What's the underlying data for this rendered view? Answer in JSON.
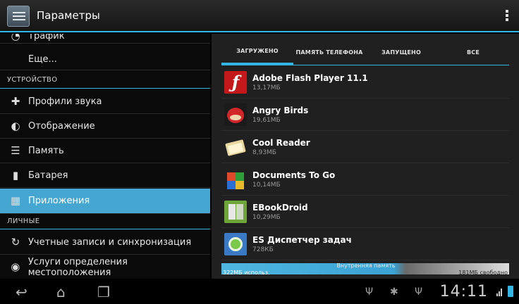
{
  "actionbar": {
    "title": "Параметры"
  },
  "sidebar": {
    "items": [
      {
        "label": "Трафик",
        "icon": "data-usage-icon"
      },
      {
        "label": "Еще...",
        "icon": null
      },
      {
        "section": "УСТРОЙСТВО"
      },
      {
        "label": "Профили звука",
        "icon": "sound-icon"
      },
      {
        "label": "Отображение",
        "icon": "display-icon"
      },
      {
        "label": "Память",
        "icon": "storage-icon"
      },
      {
        "label": "Батарея",
        "icon": "battery-icon"
      },
      {
        "label": "Приложения",
        "icon": "apps-icon",
        "selected": true
      },
      {
        "section": "ЛИЧНЫЕ"
      },
      {
        "label": "Учетные записи и синхронизация",
        "icon": "sync-icon"
      },
      {
        "label": "Услуги определения местоположения",
        "icon": "location-icon"
      }
    ]
  },
  "tabs": [
    "ЗАГРУЖЕНО",
    "ПАМЯТЬ ТЕЛЕФОНА",
    "ЗАПУЩЕНО",
    "ВСЕ"
  ],
  "active_tab": "ЗАГРУЖЕНО",
  "apps": [
    {
      "name": "Adobe Flash Player 11.1",
      "size": "13,17МБ",
      "icon": "flash-icon"
    },
    {
      "name": "Angry Birds",
      "size": "19,61МБ",
      "icon": "angry-birds-icon"
    },
    {
      "name": "Cool Reader",
      "size": "8,93МБ",
      "icon": "cool-reader-icon"
    },
    {
      "name": "Documents To Go",
      "size": "10,14МБ",
      "icon": "documents-to-go-icon"
    },
    {
      "name": "EBookDroid",
      "size": "10,29МБ",
      "icon": "ebookdroid-icon"
    },
    {
      "name": "ES Диспетчер задач",
      "size": "728КБ",
      "icon": "es-task-manager-icon"
    }
  ],
  "storage": {
    "label": "Внутренняя память",
    "used": "322МБ использ.",
    "free": "181МБ свободно",
    "used_fraction": 0.64
  },
  "statusbar": {
    "time": "14:11"
  },
  "colors": {
    "accent": "#33b5e5",
    "selected_row": "#45a6d1"
  }
}
